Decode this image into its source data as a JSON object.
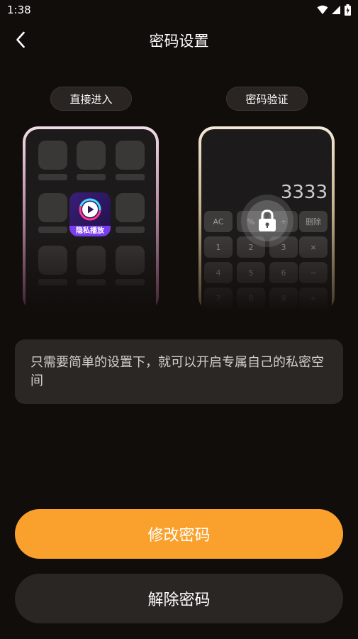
{
  "status_bar": {
    "time": "1:38",
    "icons": [
      "wifi-icon",
      "signal-icon",
      "battery-icon"
    ]
  },
  "header": {
    "title": "密码设置",
    "back_icon": "back-arrow-icon"
  },
  "modes": {
    "direct": {
      "label": "直接进入",
      "app_badge": "隐私播放",
      "app_icon": "play-icon"
    },
    "password": {
      "label": "密码验证",
      "display": "3333",
      "keys": [
        "AC",
        "%",
        "÷",
        "删除",
        "1",
        "2",
        "3",
        "×",
        "4",
        "5",
        "6",
        "−",
        "7",
        "8",
        "9",
        "+"
      ],
      "lock_icon": "lock-icon"
    }
  },
  "description": "只需要简单的设置下，就可以开启专属自己的私密空间",
  "buttons": {
    "modify": "修改密码",
    "remove": "解除密码"
  },
  "colors": {
    "background": "#110d0b",
    "accent": "#f9a12c",
    "card": "#2a2725"
  }
}
